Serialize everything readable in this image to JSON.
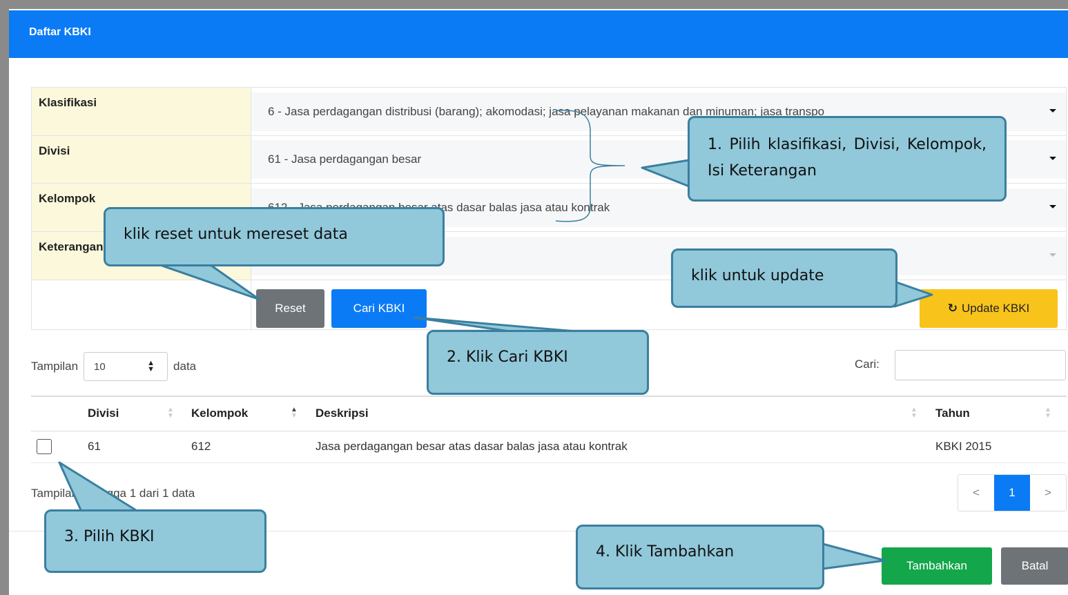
{
  "modal": {
    "title": "Daftar KBKI"
  },
  "form": {
    "rows": [
      {
        "label": "Klasifikasi",
        "value": "6 - Jasa perdagangan distribusi (barang); akomodasi; jasa pelayanan makanan dan minuman; jasa transpo"
      },
      {
        "label": "Divisi",
        "value": "61 - Jasa perdagangan besar"
      },
      {
        "label": "Kelompok",
        "value": "612 - Jasa perdagangan besar atas dasar balas jasa atau kontrak"
      },
      {
        "label": "Keterangan",
        "value": ""
      }
    ],
    "reset_label": "Reset",
    "search_label": "Cari KBKI",
    "update_label": "Update KBKI"
  },
  "table_controls": {
    "show_label": "Tampilan",
    "page_size": "10",
    "data_label": "data",
    "search_label": "Cari:"
  },
  "table": {
    "headers": [
      "Divisi",
      "Kelompok",
      "Deskripsi",
      "Tahun"
    ],
    "rows": [
      {
        "divisi": "61",
        "kelompok": "612",
        "deskripsi": "Jasa perdagangan besar atas dasar balas jasa atau kontrak",
        "tahun": "KBKI 2015"
      }
    ]
  },
  "footer": {
    "info": "Tampilan 1 hingga 1 dari 1 data",
    "prev": "<",
    "page": "1",
    "next": ">",
    "add_label": "Tambahkan",
    "cancel_label": "Batal"
  },
  "callouts": {
    "step1": "1. Pilih klasifikasi, Divisi, Kelompok, Isi Keterangan",
    "reset": "klik reset untuk mereset data",
    "update": "klik untuk update",
    "step2": "2. Klik Cari KBKI",
    "step3": "3. Pilih KBKI",
    "step4": "4. Klik Tambahkan"
  },
  "colors": {
    "header": "#0b7bf5",
    "label_bg": "#fcf8dc",
    "primary": "#0b7bf5",
    "warning": "#f8c41b",
    "success": "#14a64b",
    "secondary": "#6e7377",
    "callout_bg": "#91c8da",
    "callout_border": "#3a7fa0"
  }
}
